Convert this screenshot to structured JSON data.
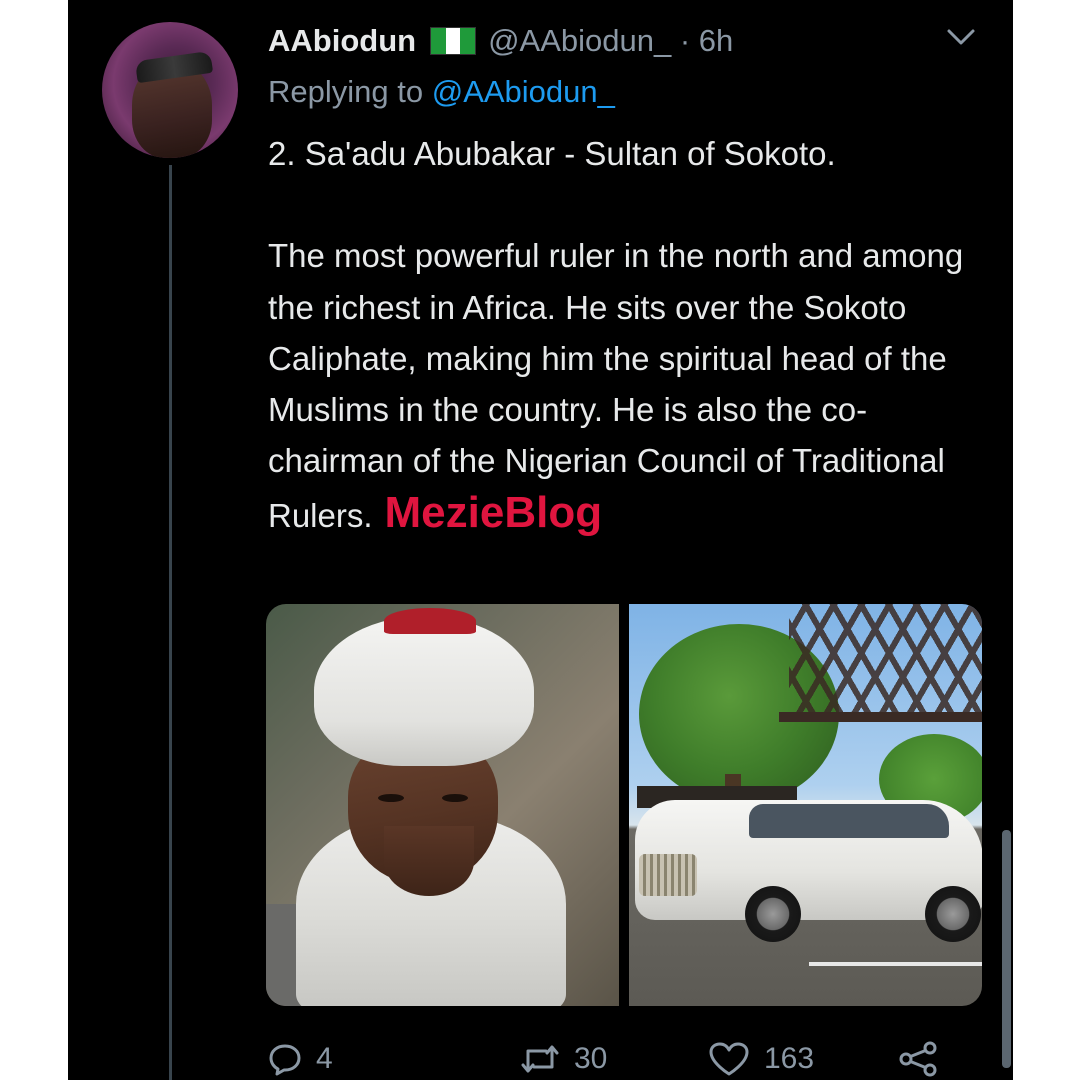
{
  "tweet": {
    "display_name": "AAbiodun",
    "handle_time": "@AAbiodun_ · 6h",
    "replying_prefix": "Replying to ",
    "replying_mention": "@AAbiodun_",
    "paragraph1": "2. Sa'adu Abubakar - Sultan of Sokoto.",
    "paragraph2": "The most powerful ruler in the north and among the richest in Africa. He sits over the Sokoto Caliphate, making him the spiritual head of the Muslims in the country. He is also the co-chairman of the Nigerian Council of Traditional Rulers.",
    "watermark": "MezieBlog"
  },
  "actions": {
    "replies": "4",
    "retweets": "30",
    "likes": "163"
  },
  "colors": {
    "background": "#000000",
    "text": "#e7e9ea",
    "secondary": "#8b98a5",
    "link": "#1d9bf0",
    "watermark": "#e0153f",
    "flag_green": "#1f9a3a"
  },
  "icons": [
    "nigeria-flag-icon",
    "chevron-down-icon",
    "reply-icon",
    "retweet-icon",
    "like-icon",
    "share-icon"
  ]
}
